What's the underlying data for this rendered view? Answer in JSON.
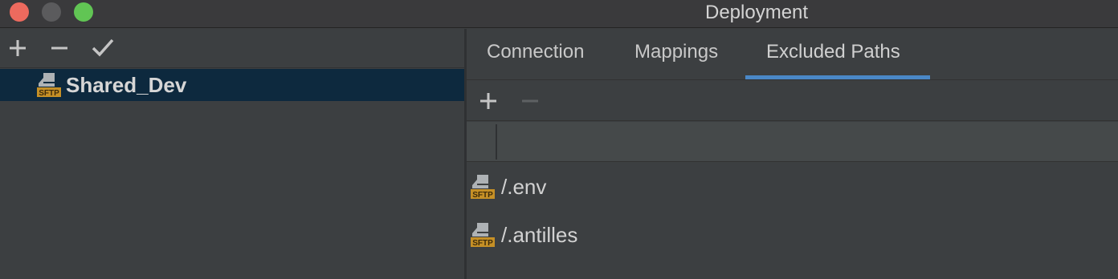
{
  "window": {
    "title": "Deployment"
  },
  "left_toolbar": {
    "add_icon": "plus-icon",
    "remove_icon": "minus-icon",
    "apply_icon": "checkmark-icon"
  },
  "servers": [
    {
      "name": "Shared_Dev",
      "icon": "sftp-server-icon",
      "selected": true
    }
  ],
  "tabs": [
    {
      "label": "Connection",
      "active": false
    },
    {
      "label": "Mappings",
      "active": false
    },
    {
      "label": "Excluded Paths",
      "active": true
    }
  ],
  "paths_toolbar": {
    "add_icon": "plus-icon",
    "remove_icon": "minus-icon",
    "remove_enabled": false
  },
  "excluded_paths": [
    {
      "path": "/.env",
      "icon": "sftp-server-icon"
    },
    {
      "path": "/.antilles",
      "icon": "sftp-server-icon"
    }
  ],
  "colors": {
    "accent": "#4a88c7",
    "selection": "#0d293e",
    "background": "#3c3f41",
    "sftp_badge": "#c69026"
  }
}
